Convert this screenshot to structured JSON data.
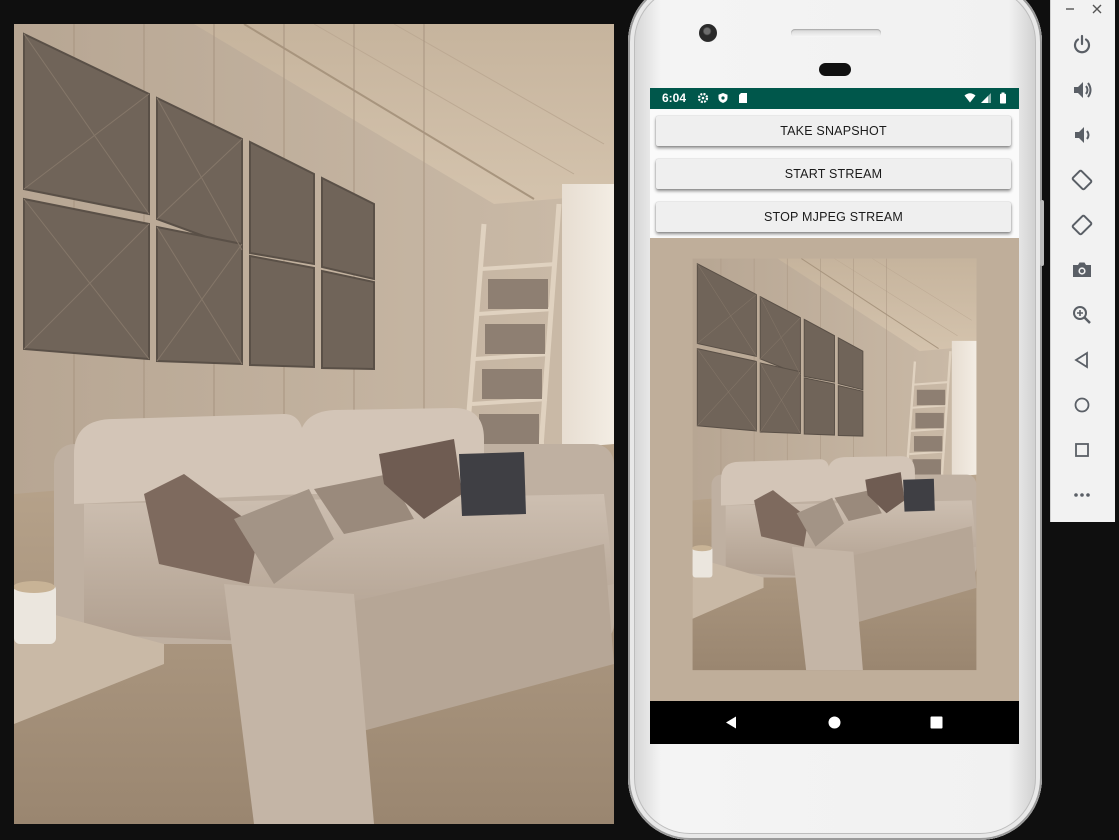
{
  "app": {
    "buttons": {
      "take_snapshot": "TAKE SNAPSHOT",
      "start_stream": "START STREAM",
      "stop_stream": "STOP MJPEG STREAM"
    }
  },
  "status_bar": {
    "time": "6:04",
    "left_icons": [
      "settings-icon",
      "shield-icon",
      "sdcard-icon"
    ],
    "right_icons": [
      "wifi-icon",
      "signal-icon",
      "battery-icon"
    ],
    "color": "#00574b"
  },
  "nav_bar": {
    "icons": [
      "back-icon",
      "home-icon",
      "recents-icon"
    ]
  },
  "emulator_toolbar": {
    "window_controls": [
      "minimize-icon",
      "close-icon"
    ],
    "tools": [
      "power-icon",
      "volume-up-icon",
      "volume-down-icon",
      "rotate-left-icon",
      "rotate-right-icon",
      "camera-icon",
      "zoom-icon",
      "back-icon",
      "home-icon",
      "overview-icon",
      "more-icon"
    ]
  },
  "colors": {
    "status_bar": "#00574b",
    "button_bg": "#efefef",
    "window_bg": "#0f0f0f"
  }
}
